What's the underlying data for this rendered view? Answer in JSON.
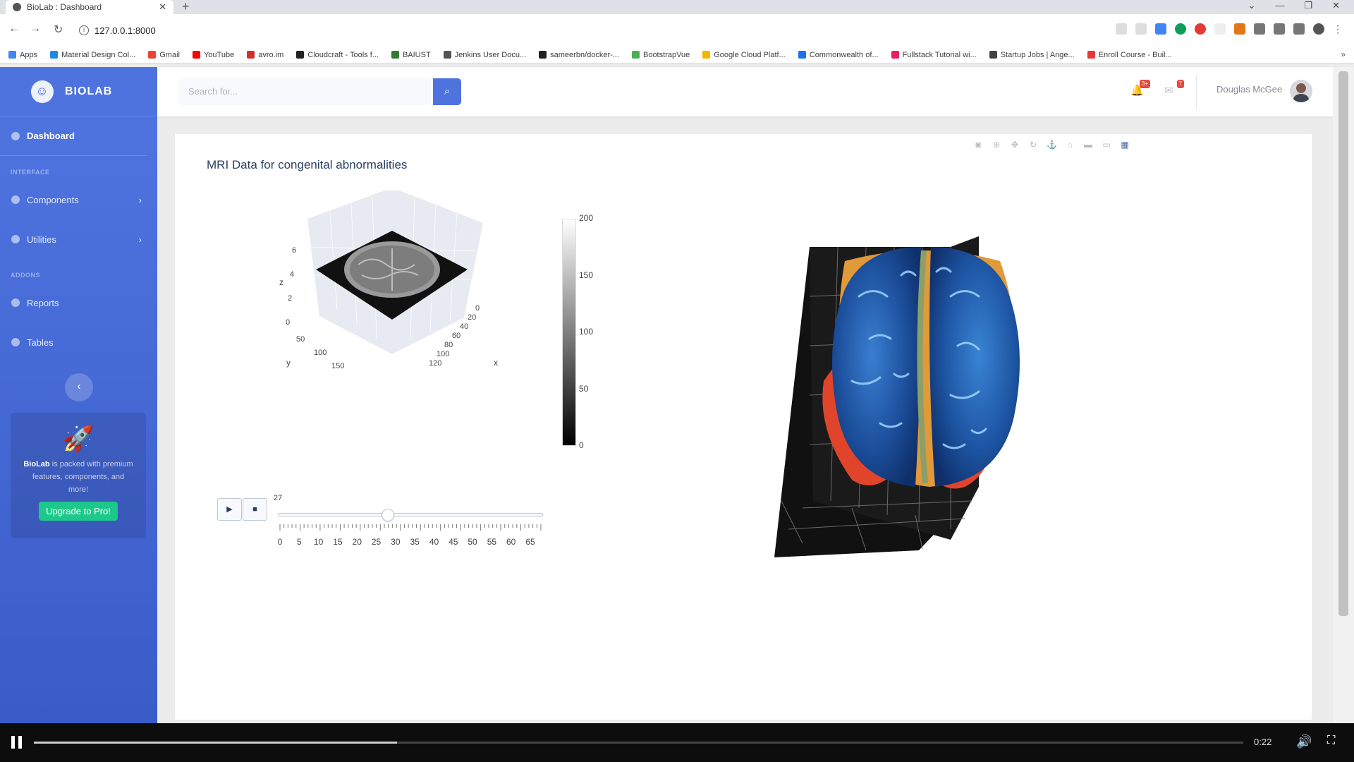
{
  "browser": {
    "tab_title": "BioLab : Dashboard",
    "new_tab": "+",
    "url": "127.0.0.1:8000",
    "bookmarks": [
      "Apps",
      "Material Design Col...",
      "Gmail",
      "YouTube",
      "avro.im",
      "Cloudcraft - Tools f...",
      "BAIUST",
      "Jenkins User Docu...",
      "sameerbn/docker-...",
      "BootstrapVue",
      "Google Cloud Platf...",
      "Commonwealth of...",
      "Fullstack Tutorial wi...",
      "Startup Jobs | Ange...",
      "Enroll Course - Buil..."
    ],
    "bookmark_colors": [
      "#4285f4",
      "#1e88e5",
      "#ea4335",
      "#ff0000",
      "#d32f2f",
      "#222222",
      "#2e7d32",
      "#555555",
      "#222222",
      "#4caf50",
      "#f4b400",
      "#1a73e8",
      "#e91e63",
      "#444444",
      "#e53935"
    ]
  },
  "sidebar": {
    "brand": "BIOLAB",
    "dashboard": "Dashboard",
    "section_interface": "INTERFACE",
    "components": "Components",
    "utilities": "Utilities",
    "section_addons": "ADDONS",
    "reports": "Reports",
    "tables": "Tables",
    "toggle": "‹",
    "promo_brand": "BioLab",
    "promo_text": " is packed with premium features, components, and more!",
    "upgrade": "Upgrade to Pro!"
  },
  "topbar": {
    "search_placeholder": "Search for...",
    "alerts_badge": "3+",
    "messages_badge": "7",
    "user_name": "Douglas McGee"
  },
  "main": {
    "card_title": "MRI Data for congenital abnormalities",
    "axis_z": "z",
    "axis_y": "y",
    "axis_x": "x",
    "z_ticks": [
      "6",
      "4",
      "2",
      "0"
    ],
    "y_ticks": [
      "50",
      "100",
      "150"
    ],
    "x_ticks": [
      "0",
      "20",
      "40",
      "60",
      "80",
      "100",
      "120"
    ],
    "colorbar_ticks": [
      "200",
      "150",
      "100",
      "50",
      "0"
    ],
    "play": "▶",
    "stop": "■",
    "slider_value": "27",
    "slider_fraction": 0.415,
    "slider_ticks": [
      "0",
      "5",
      "10",
      "15",
      "20",
      "25",
      "30",
      "35",
      "40",
      "45",
      "50",
      "55",
      "60",
      "65"
    ]
  },
  "video": {
    "time": "0:22",
    "progress": 0.3
  }
}
